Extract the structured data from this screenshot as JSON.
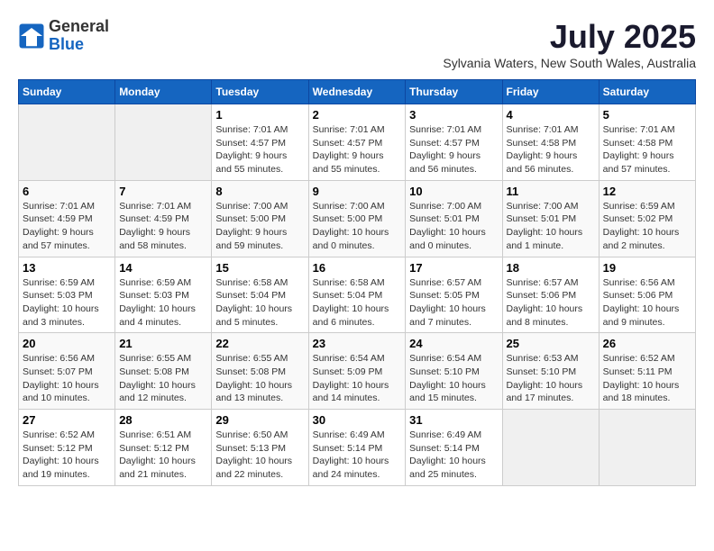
{
  "logo": {
    "general": "General",
    "blue": "Blue"
  },
  "header": {
    "month": "July 2025",
    "location": "Sylvania Waters, New South Wales, Australia"
  },
  "weekdays": [
    "Sunday",
    "Monday",
    "Tuesday",
    "Wednesday",
    "Thursday",
    "Friday",
    "Saturday"
  ],
  "weeks": [
    [
      {
        "day": null
      },
      {
        "day": null
      },
      {
        "day": "1",
        "sunrise": "7:01 AM",
        "sunset": "4:57 PM",
        "daylight": "9 hours and 55 minutes."
      },
      {
        "day": "2",
        "sunrise": "7:01 AM",
        "sunset": "4:57 PM",
        "daylight": "9 hours and 55 minutes."
      },
      {
        "day": "3",
        "sunrise": "7:01 AM",
        "sunset": "4:57 PM",
        "daylight": "9 hours and 56 minutes."
      },
      {
        "day": "4",
        "sunrise": "7:01 AM",
        "sunset": "4:58 PM",
        "daylight": "9 hours and 56 minutes."
      },
      {
        "day": "5",
        "sunrise": "7:01 AM",
        "sunset": "4:58 PM",
        "daylight": "9 hours and 57 minutes."
      }
    ],
    [
      {
        "day": "6",
        "sunrise": "7:01 AM",
        "sunset": "4:59 PM",
        "daylight": "9 hours and 57 minutes."
      },
      {
        "day": "7",
        "sunrise": "7:01 AM",
        "sunset": "4:59 PM",
        "daylight": "9 hours and 58 minutes."
      },
      {
        "day": "8",
        "sunrise": "7:00 AM",
        "sunset": "5:00 PM",
        "daylight": "9 hours and 59 minutes."
      },
      {
        "day": "9",
        "sunrise": "7:00 AM",
        "sunset": "5:00 PM",
        "daylight": "10 hours and 0 minutes."
      },
      {
        "day": "10",
        "sunrise": "7:00 AM",
        "sunset": "5:01 PM",
        "daylight": "10 hours and 0 minutes."
      },
      {
        "day": "11",
        "sunrise": "7:00 AM",
        "sunset": "5:01 PM",
        "daylight": "10 hours and 1 minute."
      },
      {
        "day": "12",
        "sunrise": "6:59 AM",
        "sunset": "5:02 PM",
        "daylight": "10 hours and 2 minutes."
      }
    ],
    [
      {
        "day": "13",
        "sunrise": "6:59 AM",
        "sunset": "5:03 PM",
        "daylight": "10 hours and 3 minutes."
      },
      {
        "day": "14",
        "sunrise": "6:59 AM",
        "sunset": "5:03 PM",
        "daylight": "10 hours and 4 minutes."
      },
      {
        "day": "15",
        "sunrise": "6:58 AM",
        "sunset": "5:04 PM",
        "daylight": "10 hours and 5 minutes."
      },
      {
        "day": "16",
        "sunrise": "6:58 AM",
        "sunset": "5:04 PM",
        "daylight": "10 hours and 6 minutes."
      },
      {
        "day": "17",
        "sunrise": "6:57 AM",
        "sunset": "5:05 PM",
        "daylight": "10 hours and 7 minutes."
      },
      {
        "day": "18",
        "sunrise": "6:57 AM",
        "sunset": "5:06 PM",
        "daylight": "10 hours and 8 minutes."
      },
      {
        "day": "19",
        "sunrise": "6:56 AM",
        "sunset": "5:06 PM",
        "daylight": "10 hours and 9 minutes."
      }
    ],
    [
      {
        "day": "20",
        "sunrise": "6:56 AM",
        "sunset": "5:07 PM",
        "daylight": "10 hours and 10 minutes."
      },
      {
        "day": "21",
        "sunrise": "6:55 AM",
        "sunset": "5:08 PM",
        "daylight": "10 hours and 12 minutes."
      },
      {
        "day": "22",
        "sunrise": "6:55 AM",
        "sunset": "5:08 PM",
        "daylight": "10 hours and 13 minutes."
      },
      {
        "day": "23",
        "sunrise": "6:54 AM",
        "sunset": "5:09 PM",
        "daylight": "10 hours and 14 minutes."
      },
      {
        "day": "24",
        "sunrise": "6:54 AM",
        "sunset": "5:10 PM",
        "daylight": "10 hours and 15 minutes."
      },
      {
        "day": "25",
        "sunrise": "6:53 AM",
        "sunset": "5:10 PM",
        "daylight": "10 hours and 17 minutes."
      },
      {
        "day": "26",
        "sunrise": "6:52 AM",
        "sunset": "5:11 PM",
        "daylight": "10 hours and 18 minutes."
      }
    ],
    [
      {
        "day": "27",
        "sunrise": "6:52 AM",
        "sunset": "5:12 PM",
        "daylight": "10 hours and 19 minutes."
      },
      {
        "day": "28",
        "sunrise": "6:51 AM",
        "sunset": "5:12 PM",
        "daylight": "10 hours and 21 minutes."
      },
      {
        "day": "29",
        "sunrise": "6:50 AM",
        "sunset": "5:13 PM",
        "daylight": "10 hours and 22 minutes."
      },
      {
        "day": "30",
        "sunrise": "6:49 AM",
        "sunset": "5:14 PM",
        "daylight": "10 hours and 24 minutes."
      },
      {
        "day": "31",
        "sunrise": "6:49 AM",
        "sunset": "5:14 PM",
        "daylight": "10 hours and 25 minutes."
      },
      {
        "day": null
      },
      {
        "day": null
      }
    ]
  ]
}
